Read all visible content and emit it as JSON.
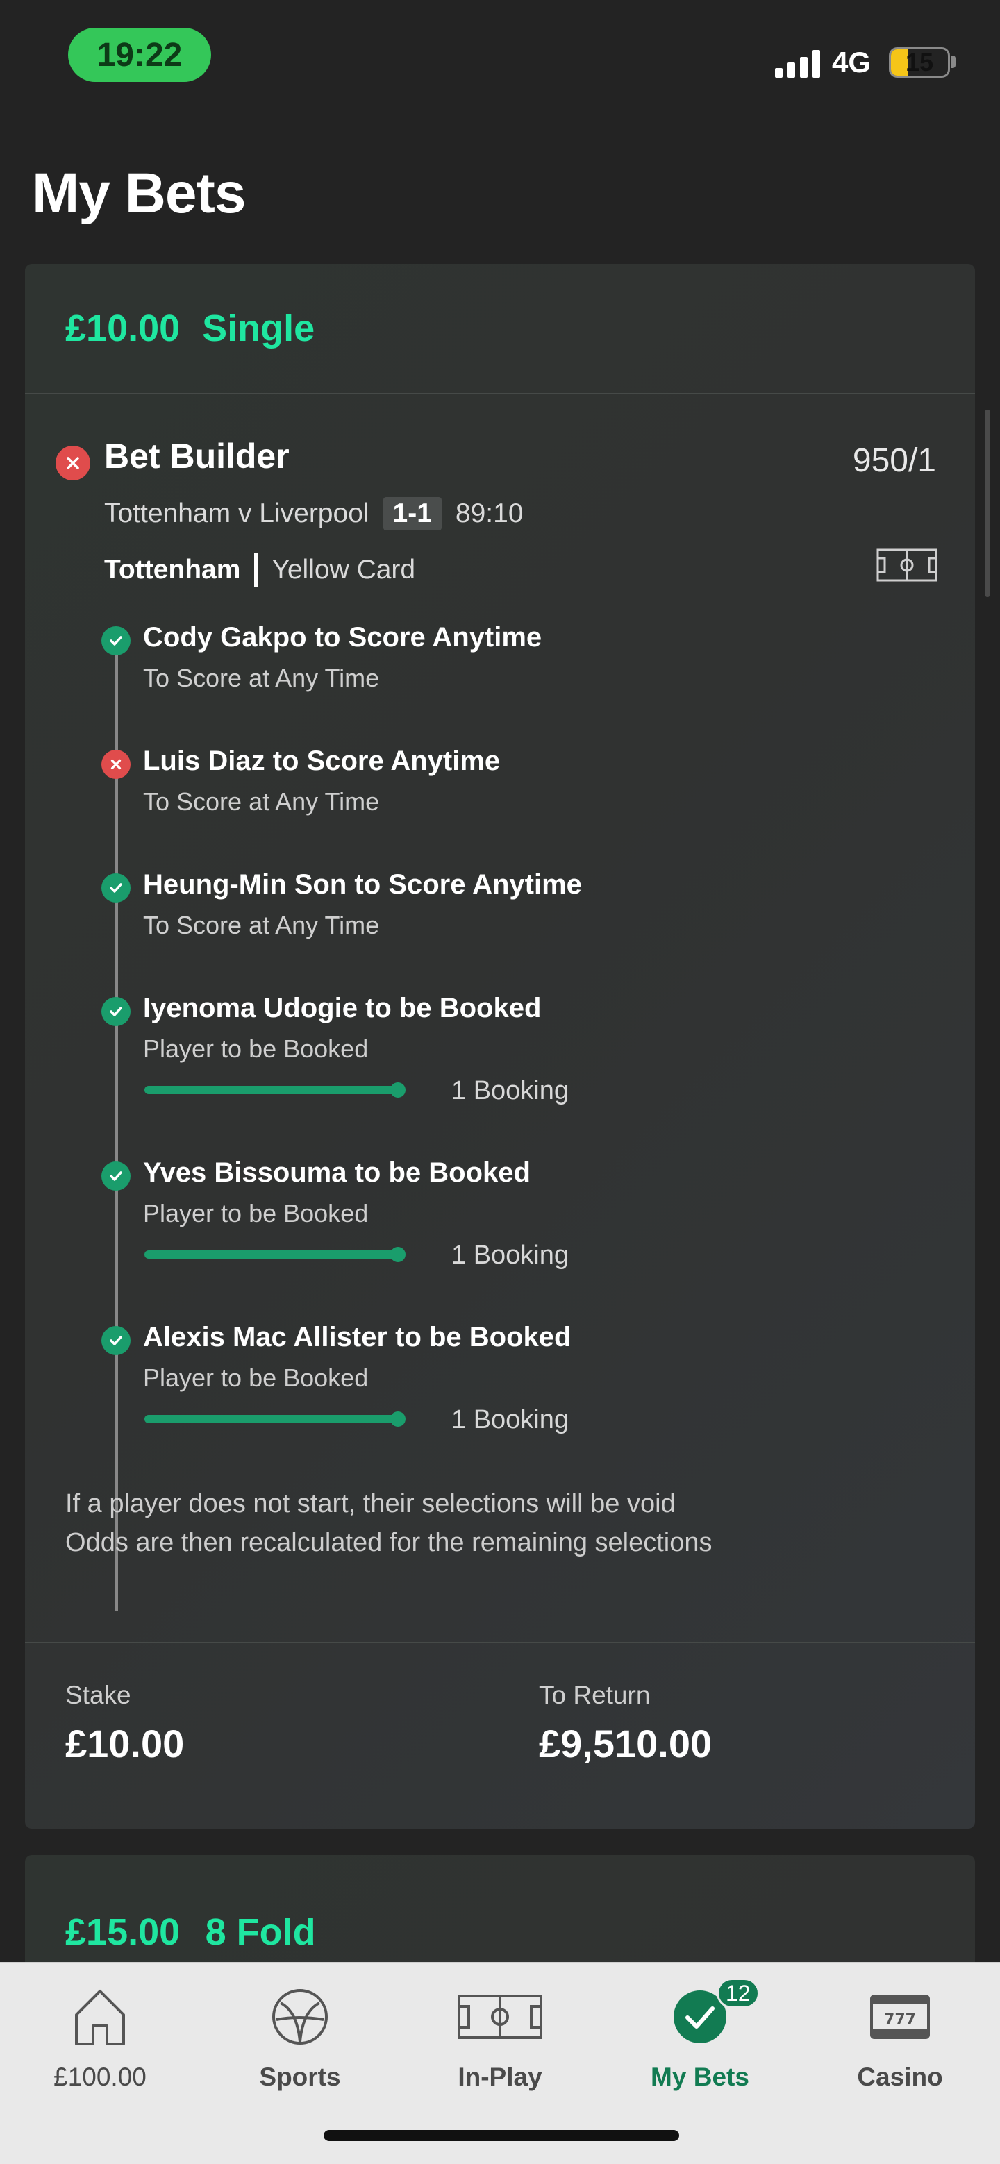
{
  "status_bar": {
    "time": "19:22",
    "network": "4G",
    "battery": "15",
    "colors": {
      "time_pill": "#34c759",
      "battery_fill": "#f5c518"
    }
  },
  "page": {
    "title": "My Bets"
  },
  "bet": {
    "stake_header": "£10.00",
    "bet_type": "Single",
    "market_title": "Bet Builder",
    "odds": "950/1",
    "match": "Tottenham v Liverpool",
    "score": "1-1",
    "clock": "89:10",
    "team": "Tottenham",
    "event": "Yellow Card",
    "selections": [
      {
        "name": "Cody Gakpo to Score Anytime",
        "market": "To Score at Any Time",
        "status": "won",
        "icon": "check-icon"
      },
      {
        "name": "Luis Diaz to Score Anytime",
        "market": "To Score at Any Time",
        "status": "lost",
        "icon": "cross-icon"
      },
      {
        "name": "Heung-Min Son to Score Anytime",
        "market": "To Score at Any Time",
        "status": "won",
        "icon": "check-icon"
      },
      {
        "name": "Iyenoma Udogie to be Booked",
        "market": "Player to be Booked",
        "status": "won",
        "icon": "check-icon",
        "progress_label": "1 Booking",
        "progress": 1.0
      },
      {
        "name": "Yves Bissouma to be Booked",
        "market": "Player to be Booked",
        "status": "won",
        "icon": "check-icon",
        "progress_label": "1 Booking",
        "progress": 1.0
      },
      {
        "name": "Alexis Mac Allister to be Booked",
        "market": "Player to be Booked",
        "status": "won",
        "icon": "check-icon",
        "progress_label": "1 Booking",
        "progress": 1.0
      }
    ],
    "void_note_line1": "If a player does not start, their selections will be void",
    "void_note_line2": "Odds are then recalculated for the remaining selections",
    "stake_label": "Stake",
    "stake_value": "£10.00",
    "return_label": "To Return",
    "return_value": "£9,510.00",
    "colors": {
      "accent": "#1fe6a0",
      "win": "#1a9d6c",
      "lose": "#e04c4c"
    }
  },
  "next_bet": {
    "stake": "£15.00",
    "bet_type": "8 Fold"
  },
  "bottom_nav": {
    "items": [
      {
        "label": "£100.00",
        "icon": "home-icon"
      },
      {
        "label": "Sports",
        "icon": "football-icon"
      },
      {
        "label": "In-Play",
        "icon": "pitch-icon"
      },
      {
        "label": "My Bets",
        "icon": "check-circle-icon",
        "badge": "12",
        "active": true
      },
      {
        "label": "Casino",
        "icon": "slot-machine-icon"
      }
    ],
    "active_color": "#127b52"
  }
}
